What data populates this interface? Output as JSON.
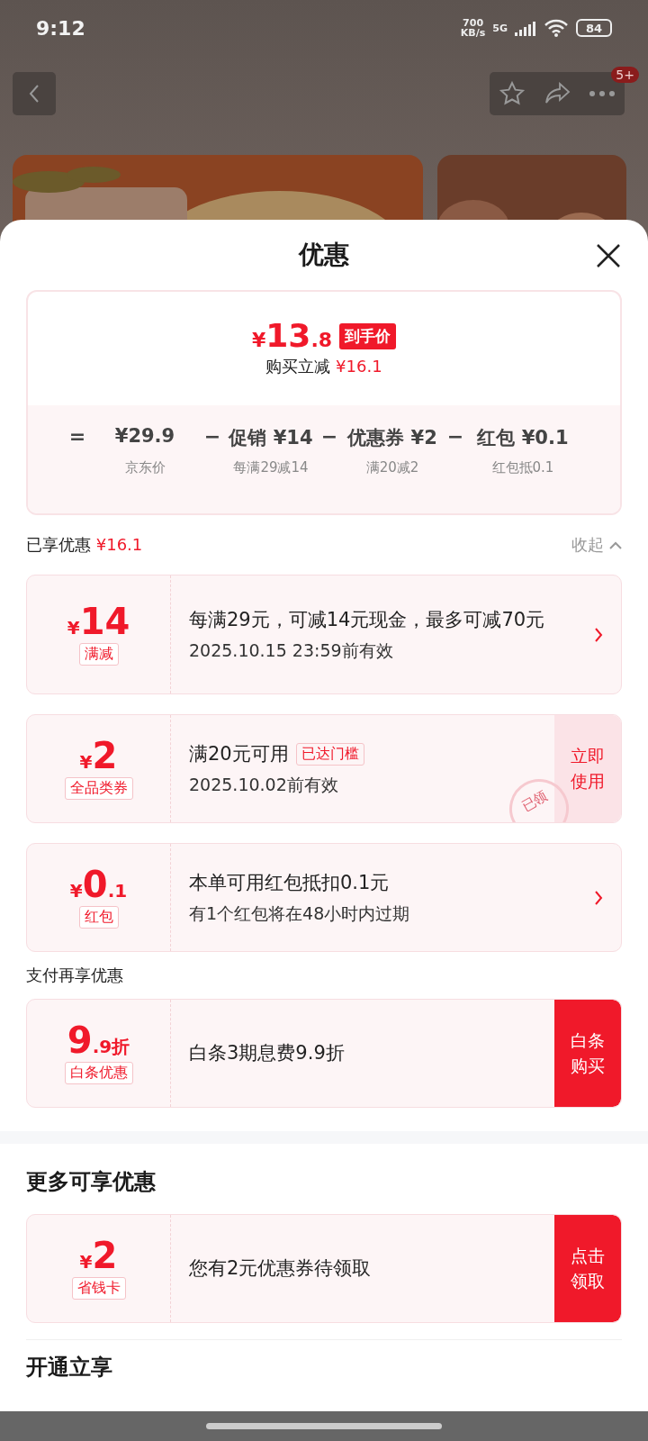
{
  "status_bar": {
    "time": "9:12",
    "speed_value": "700",
    "speed_unit": "KB/s",
    "network": "5G",
    "battery": "84"
  },
  "nav": {
    "badge": "5+"
  },
  "sheet": {
    "title": "优惠"
  },
  "price_card": {
    "currency": "¥",
    "price_main": "13",
    "price_fraction": ".8",
    "price_tag": "到手价",
    "savings_label": "购买立减",
    "savings_value": "¥16.1",
    "breakdown": [
      {
        "operator": "=",
        "value": "¥29.9",
        "note": "京东价"
      },
      {
        "operator": "−",
        "label": "促销",
        "value": "¥14",
        "note": "每满29减14"
      },
      {
        "operator": "−",
        "label": "优惠券",
        "value": "¥2",
        "note": "满20减2"
      },
      {
        "operator": "−",
        "label": "红包",
        "value": "¥0.1",
        "note": "红包抵0.1"
      }
    ]
  },
  "enjoyed": {
    "label": "已享优惠",
    "value": "¥16.1",
    "toggle": "收起",
    "expanded": true
  },
  "coupons": [
    {
      "currency": "¥",
      "amount_main": "14",
      "tag": "满减",
      "title": "每满29元，可减14元现金，最多可减70元",
      "subtitle": "2025.10.15 23:59前有效",
      "action": {
        "kind": "chevron"
      }
    },
    {
      "currency": "¥",
      "amount_main": "2",
      "tag": "全品类券",
      "title": "满20元可用",
      "badge": "已达门槛",
      "subtitle": "2025.10.02前有效",
      "stamp": "已领",
      "action": {
        "kind": "light_button",
        "label": "立即使用"
      }
    },
    {
      "currency": "¥",
      "amount_main": "0",
      "amount_fraction": ".1",
      "tag": "红包",
      "title": "本单可用红包抵扣0.1元",
      "subtitle": "有1个红包将在48小时内过期",
      "action": {
        "kind": "chevron"
      }
    }
  ],
  "payment_section": {
    "title": "支付再享优惠",
    "coupons": [
      {
        "amount_main": "9",
        "amount_fraction": ".9折",
        "tag": "白条优惠",
        "title": "白条3期息费9.9折",
        "action": {
          "kind": "solid_button",
          "label": "白条购买"
        }
      }
    ]
  },
  "more_section": {
    "title": "更多可享优惠",
    "coupons": [
      {
        "currency": "¥",
        "amount_main": "2",
        "tag": "省钱卡",
        "title": "您有2元优惠券待领取",
        "action": {
          "kind": "solid_button",
          "label": "点击领取"
        }
      }
    ]
  },
  "next_section": {
    "title": "开通立享"
  }
}
